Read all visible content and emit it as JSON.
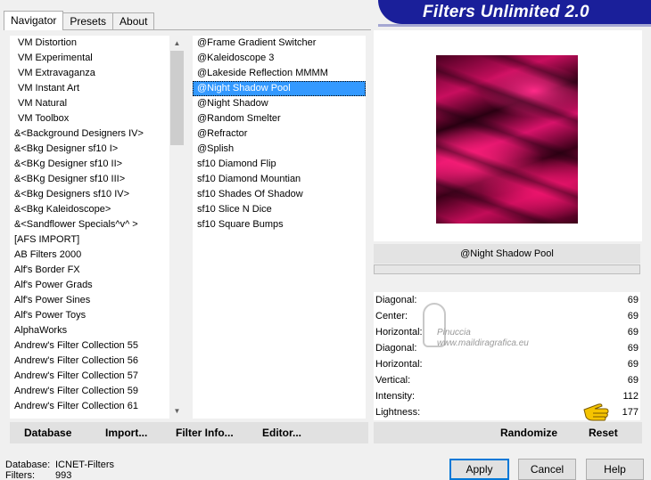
{
  "tabs": [
    {
      "label": "Navigator",
      "active": true
    },
    {
      "label": "Presets",
      "active": false
    },
    {
      "label": "About",
      "active": false
    }
  ],
  "banner": {
    "title": "Filters Unlimited 2.0"
  },
  "categories": [
    "VM Distortion",
    "VM Experimental",
    "VM Extravaganza",
    "VM Instant Art",
    "VM Natural",
    "VM Toolbox",
    "&<Background Designers IV>",
    "&<Bkg Designer sf10 I>",
    "&<BKg Designer sf10 II>",
    "&<BKg Designer sf10 III>",
    "&<Bkg Designers sf10 IV>",
    "&<Bkg Kaleidoscope>",
    "&<Sandflower Specials^v^ >",
    "[AFS IMPORT]",
    "AB Filters 2000",
    "Alf's Border FX",
    "Alf's Power Grads",
    "Alf's Power Sines",
    "Alf's Power Toys",
    "AlphaWorks",
    "Andrew's Filter Collection 55",
    "Andrew's Filter Collection 56",
    "Andrew's Filter Collection 57",
    "Andrew's Filter Collection 59",
    "Andrew's Filter Collection 61"
  ],
  "filters": [
    "@Frame Gradient Switcher",
    "@Kaleidoscope 3",
    "@Lakeside Reflection MMMM",
    "@Night Shadow Pool",
    "@Night Shadow",
    "@Random Smelter",
    "@Refractor",
    "@Splish",
    "sf10 Diamond Flip",
    "sf10 Diamond Mountian",
    "sf10 Shades Of Shadow",
    "sf10 Slice N Dice",
    "sf10 Square Bumps"
  ],
  "selected_filter_index": 3,
  "left_buttons": {
    "database": "Database",
    "import": "Import...",
    "filter_info": "Filter Info...",
    "editor": "Editor..."
  },
  "preview": {
    "filter_name": "@Night Shadow Pool"
  },
  "params": [
    {
      "label": "Diagonal:",
      "value": "69"
    },
    {
      "label": "Center:",
      "value": "69"
    },
    {
      "label": "Horizontal:",
      "value": "69"
    },
    {
      "label": "Diagonal:",
      "value": "69"
    },
    {
      "label": "Horizontal:",
      "value": "69"
    },
    {
      "label": "Vertical:",
      "value": "69"
    },
    {
      "label": "Intensity:",
      "value": "112"
    },
    {
      "label": "Lightness:",
      "value": "177"
    }
  ],
  "watermark": {
    "line1": "Pinuccia",
    "line2": "www.maildiragrafica.eu"
  },
  "right_buttons": {
    "randomize": "Randomize",
    "reset": "Reset"
  },
  "footer": {
    "database_label": "Database:",
    "database_value": "ICNET-Filters",
    "filters_label": "Filters:",
    "filters_value": "993"
  },
  "dialog_buttons": {
    "apply": "Apply",
    "cancel": "Cancel",
    "help": "Help"
  },
  "colors": {
    "banner": "#1a1f9a",
    "selection": "#3399ff",
    "preview_accent": "#e0126a"
  }
}
